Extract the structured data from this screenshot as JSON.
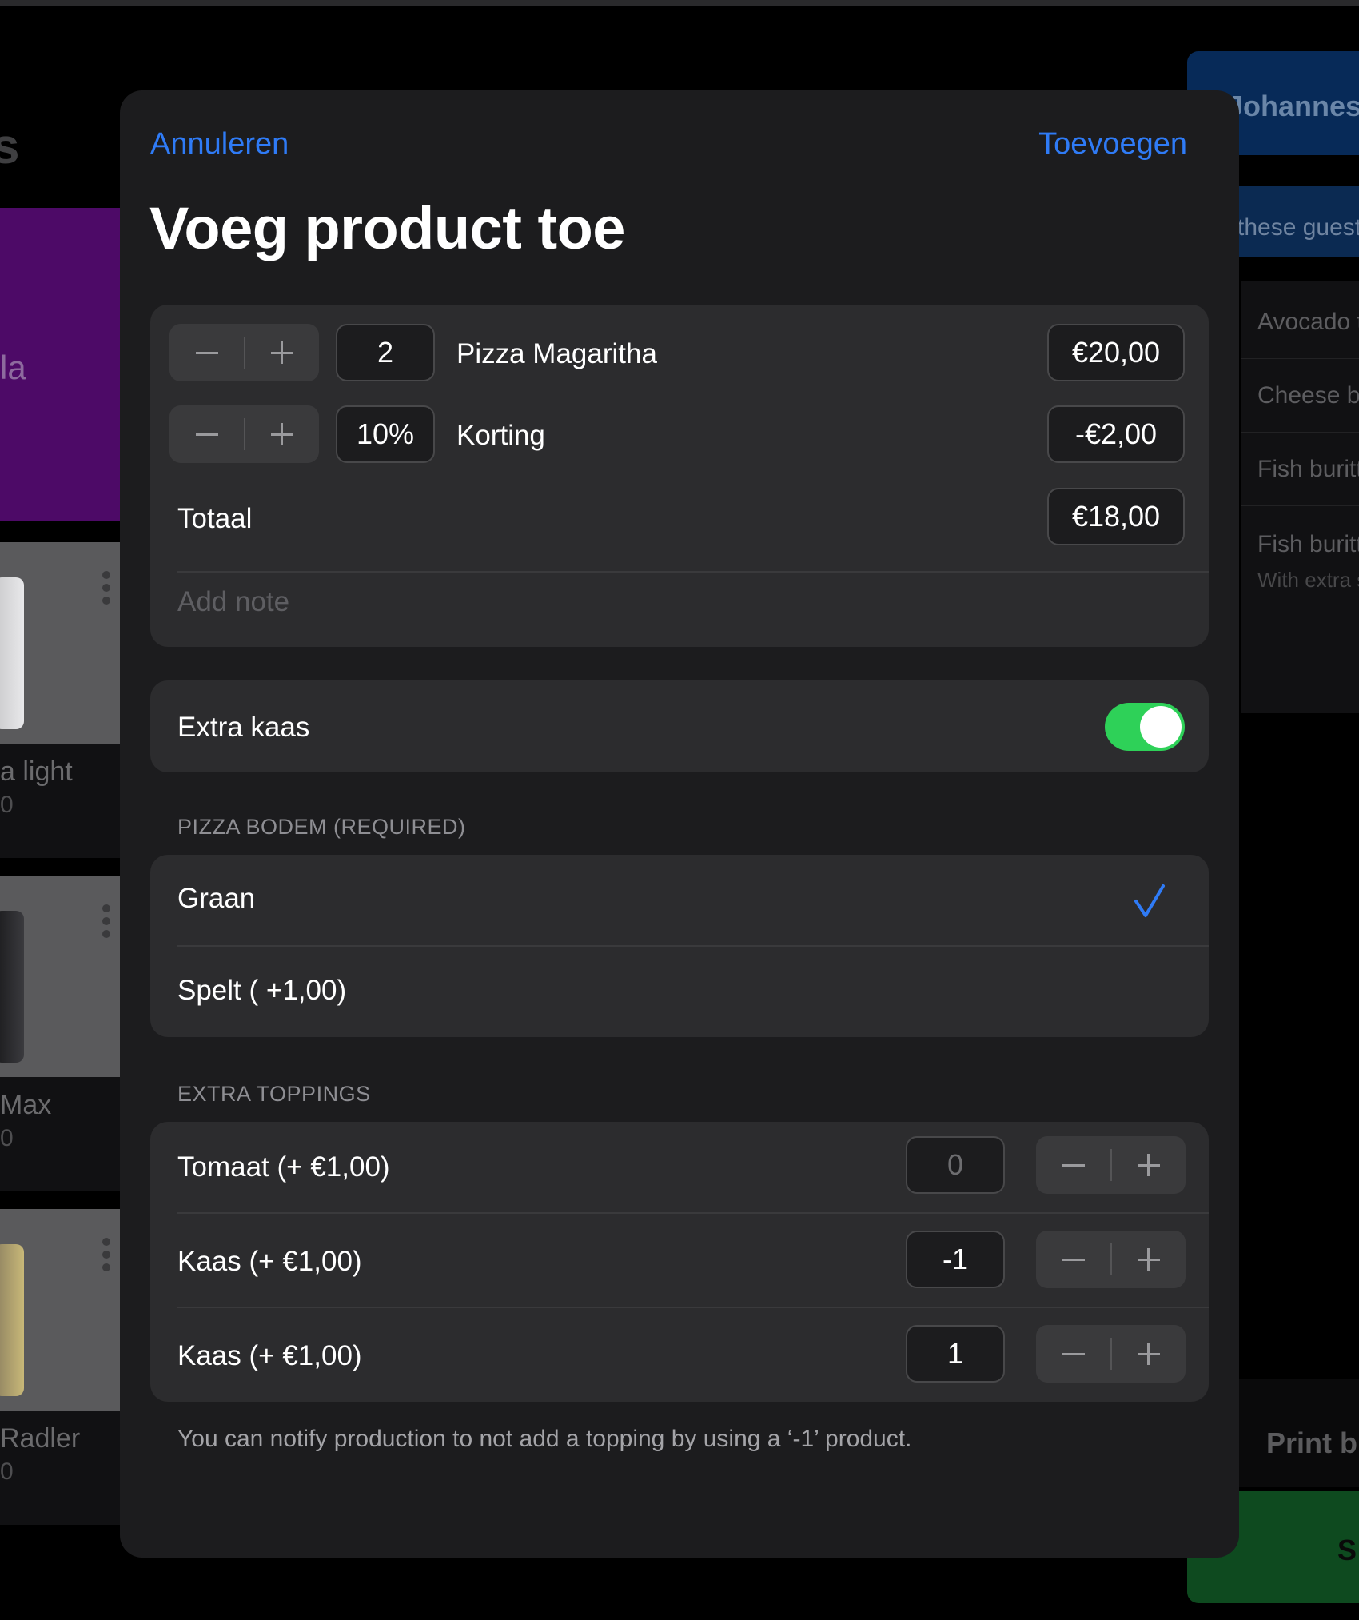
{
  "background_left": {
    "heading_fragment": "s",
    "purple_tile_text": "la",
    "products": [
      {
        "name": "a light",
        "price": "0"
      },
      {
        "name": "Max",
        "price": "0"
      },
      {
        "name": "Radler",
        "price": "0"
      }
    ]
  },
  "background_right": {
    "guest_name": "Johannes",
    "guests_button": "these guest",
    "order_items": [
      {
        "name": "Avocado t",
        "sub": ""
      },
      {
        "name": "Cheese b",
        "sub": ""
      },
      {
        "name": "Fish buritt",
        "sub": ""
      },
      {
        "name": "Fish buritt",
        "sub": "With extra s"
      }
    ],
    "print_bill": "Print bil",
    "green_button": "S"
  },
  "modal": {
    "cancel_label": "Annuleren",
    "add_label": "Toevoegen",
    "title": "Voeg product toe",
    "product": {
      "quantity": "2",
      "name": "Pizza Magaritha",
      "price": "€20,00"
    },
    "discount": {
      "value": "10%",
      "name": "Korting",
      "amount": "-€2,00"
    },
    "total": {
      "label": "Totaal",
      "amount": "€18,00"
    },
    "note_placeholder": "Add note",
    "extra_cheese": {
      "label": "Extra  kaas",
      "enabled": true
    },
    "base_section": {
      "header": "PIZZA BODEM (REQUIRED)",
      "options": [
        {
          "label": "Graan",
          "selected": true
        },
        {
          "label": "Spelt ( +1,00)",
          "selected": false
        }
      ]
    },
    "toppings_section": {
      "header": "EXTRA TOPPINGS",
      "items": [
        {
          "label": "Tomaat (+ €1,00)",
          "quantity": "0"
        },
        {
          "label": "Kaas (+ €1,00)",
          "quantity": "-1"
        },
        {
          "label": "Kaas (+ €1,00)",
          "quantity": "1"
        }
      ]
    },
    "footnote": "You can notify production to not add a topping by using a ‘-1’ product."
  },
  "colors": {
    "accent": "#2f7bf6",
    "toggle_on": "#2ed158",
    "modal_bg": "#1c1c1e",
    "group_bg": "#2c2c2e"
  }
}
